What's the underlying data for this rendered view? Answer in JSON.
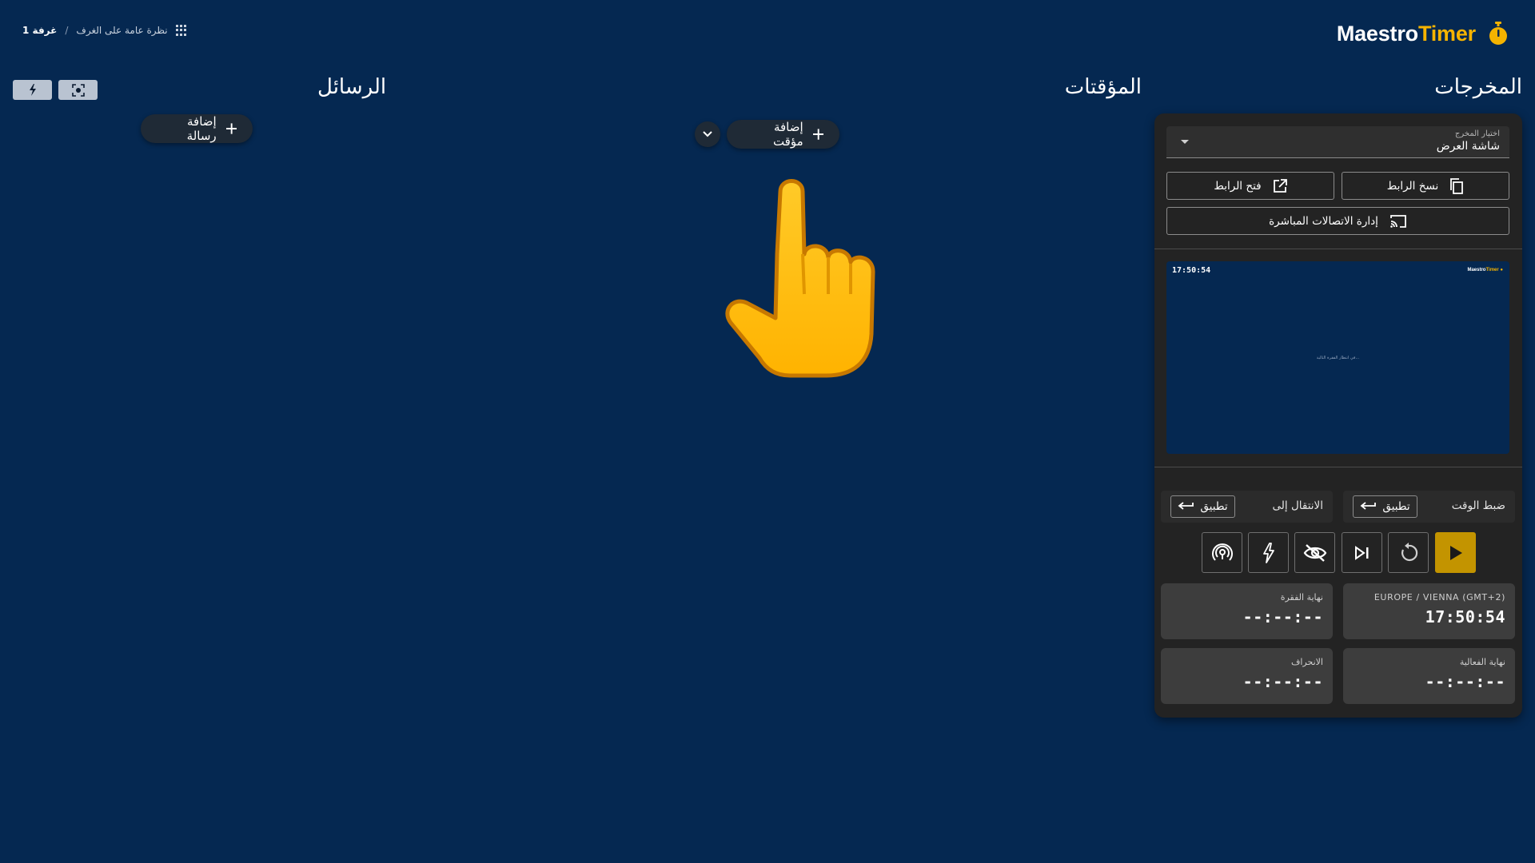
{
  "logo": {
    "part1": "Maestro",
    "part2": "Timer",
    "icon": "stopwatch-icon",
    "accent": "#f5b300"
  },
  "breadcrumb": {
    "overview": "نظرة عامة على الغرف",
    "separator": "/",
    "room": "غرفة 1",
    "icon": "grid-icon"
  },
  "toolbar": {
    "flash_icon": "flash-icon",
    "focus_icon": "focus-mode-icon"
  },
  "sections": {
    "outputs": "المخرجات",
    "timers": "المؤقتات",
    "messages": "الرسائل"
  },
  "messages": {
    "add_label": "إضافة رسالة"
  },
  "timers": {
    "add_label": "إضافة مؤقت",
    "menu_icon": "chevron-down-icon"
  },
  "output": {
    "select_label": "اختيار المخرج",
    "select_value": "شاشة العرض",
    "copy_link": "نسخ الرابط",
    "open_link": "فتح الرابط",
    "manage_connections": "إدارة الاتصالات المباشرة",
    "preview": {
      "time": "17:50:54",
      "logo_part1": "Maestro",
      "logo_part2": "Timer",
      "waiting_text": "في انتظار الفقرة التالية..."
    }
  },
  "tools": {
    "set_time": "ضبط الوقت",
    "goto": "الانتقال إلى",
    "apply": "تطبيق"
  },
  "controls": {
    "play_color": "#c39400",
    "icons": [
      "play-icon",
      "reset-icon",
      "next-icon",
      "blackout-icon",
      "flash-icon",
      "connect-icon"
    ]
  },
  "info": {
    "timezone_label": "EUROPE / VIENNA (GMT+2)",
    "timezone_time": "17:50:54",
    "segment_end_label": "نهاية الفقرة",
    "segment_end_value": "--:--:--",
    "event_end_label": "نهاية الفعالية",
    "event_end_value": "--:--:--",
    "drift_label": "الانحراف",
    "drift_value": "--:--:--"
  },
  "colors": {
    "background": "#052851",
    "panel": "#232323",
    "accent": "#f5b300"
  }
}
